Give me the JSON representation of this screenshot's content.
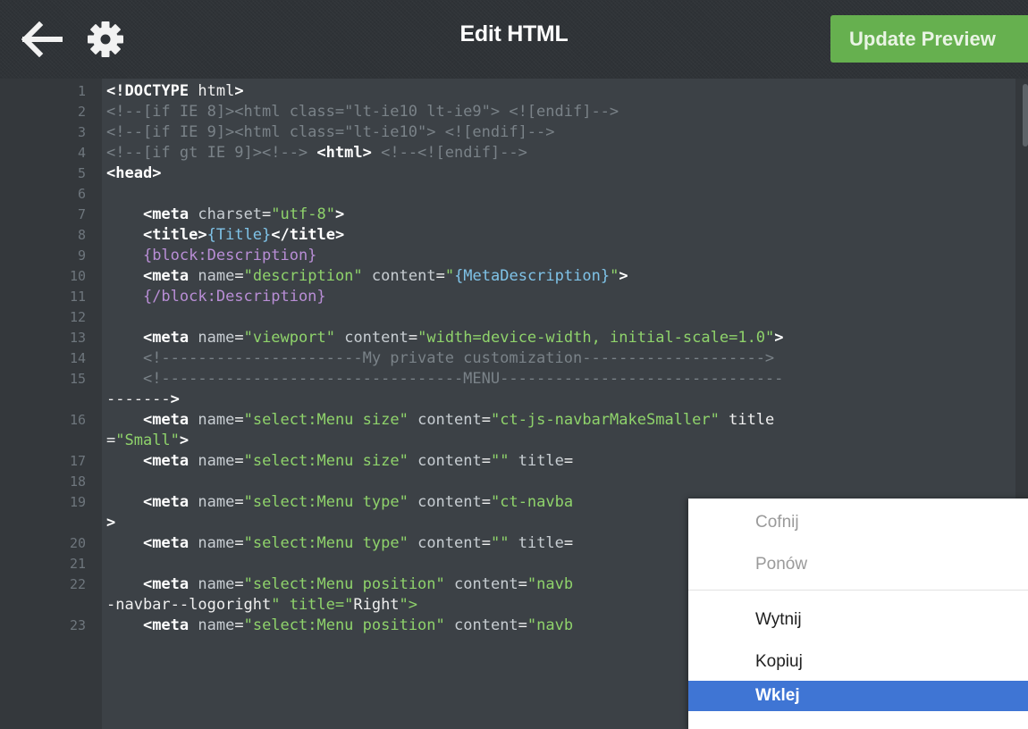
{
  "header": {
    "title": "Edit HTML",
    "back_icon": "arrow-left-icon",
    "settings_icon": "gear-icon",
    "update_button": "Update Preview"
  },
  "colors": {
    "tag": "#ffffff",
    "attr": "#c8ced3",
    "string": "#8fd36b",
    "comment": "#7a8288",
    "block": "#b98ed6",
    "accent_green": "#66b04f",
    "menu_highlight": "#3f75d4"
  },
  "editor": {
    "lines": [
      {
        "n": "1",
        "t": "<!DOCTYPE html>"
      },
      {
        "n": "2",
        "t": "<!--[if IE 8]><html class=\"lt-ie10 lt-ie9\"> <![endif]-->"
      },
      {
        "n": "3",
        "t": "<!--[if IE 9]><html class=\"lt-ie10\"> <![endif]-->"
      },
      {
        "n": "4",
        "t": "<!--[if gt IE 9]><!--> <html> <!--<![endif]-->"
      },
      {
        "n": "5",
        "t": "<head>"
      },
      {
        "n": "6",
        "t": ""
      },
      {
        "n": "7",
        "t": "    <meta charset=\"utf-8\">"
      },
      {
        "n": "8",
        "t": "    <title>{Title}</title>"
      },
      {
        "n": "9",
        "t": "    {block:Description}"
      },
      {
        "n": "10",
        "t": "    <meta name=\"description\" content=\"{MetaDescription}\">"
      },
      {
        "n": "11",
        "t": "    {/block:Description}"
      },
      {
        "n": "12",
        "t": ""
      },
      {
        "n": "13",
        "t": "    <meta name=\"viewport\" content=\"width=device-width, initial-scale=1.0\">"
      },
      {
        "n": "14",
        "t": "    <!----------------------My private customization-------------------->"
      },
      {
        "n": "15",
        "t": "    <!---------------------------------MENU-------------------------------"
      },
      {
        "n": "",
        "t": "------->"
      },
      {
        "n": "16",
        "t": "    <meta name=\"select:Menu size\" content=\"ct-js-navbarMakeSmaller\" title"
      },
      {
        "n": "",
        "t": "=\"Small\">"
      },
      {
        "n": "17",
        "t": "    <meta name=\"select:Menu size\" content=\"\" title="
      },
      {
        "n": "18",
        "t": ""
      },
      {
        "n": "19",
        "t": "    <meta name=\"select:Menu type\" content=\"ct-navba"
      },
      {
        "n": "",
        "t": ">"
      },
      {
        "n": "20",
        "t": "    <meta name=\"select:Menu type\" content=\"\" title="
      },
      {
        "n": "21",
        "t": ""
      },
      {
        "n": "22",
        "t": "    <meta name=\"select:Menu position\" content=\"navb"
      },
      {
        "n": "",
        "t": "-navbar--logoright\" title=\"Right\">"
      },
      {
        "n": "23",
        "t": "    <meta name=\"select:Menu position\" content=\"navb"
      }
    ]
  },
  "context_menu": {
    "items": [
      {
        "label": "Cofnij",
        "state": "disabled"
      },
      {
        "label": "Ponów",
        "state": "disabled"
      },
      {
        "label": "Wytnij",
        "state": "enabled"
      },
      {
        "label": "Kopiuj",
        "state": "enabled"
      },
      {
        "label": "Wklej",
        "state": "active"
      }
    ]
  }
}
